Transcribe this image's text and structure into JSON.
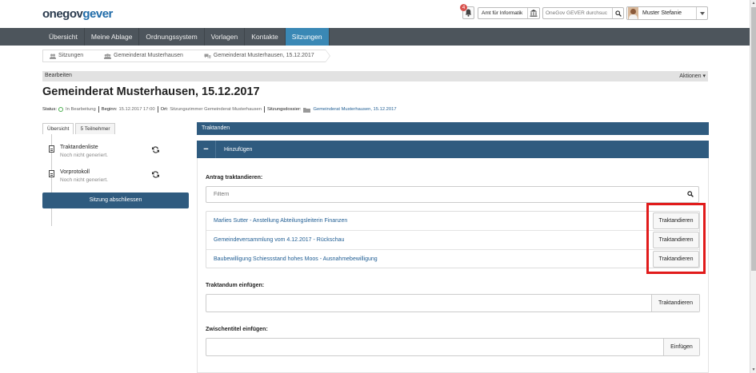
{
  "header": {
    "logo_one": "onegov",
    "logo_gever": "gever",
    "notification_count": "4",
    "org_unit": "Amt für Informatik",
    "search_placeholder": "OneGov GEVER durchsuc",
    "user_name": "Muster Stefanie"
  },
  "nav": {
    "items": [
      {
        "label": "Übersicht"
      },
      {
        "label": "Meine Ablage"
      },
      {
        "label": "Ordnungssystem"
      },
      {
        "label": "Vorlagen"
      },
      {
        "label": "Kontakte"
      },
      {
        "label": "Sitzungen"
      }
    ],
    "active": "Sitzungen"
  },
  "breadcrumb": [
    {
      "label": "Sitzungen"
    },
    {
      "label": "Gemeinderat Musterhausen"
    },
    {
      "label": "Gemeinderat Musterhausen, 15.12.2017"
    }
  ],
  "actionbar": {
    "edit_label": "Bearbeiten",
    "actions_label": "Aktionen ▾"
  },
  "page": {
    "title": "Gemeinderat Musterhausen, 15.12.2017",
    "meta": {
      "status_label": "Status:",
      "status_value": "In Bearbeitung",
      "start_label": "Beginn:",
      "start_value": "15.12.2017 17:00",
      "place_label": "Ort:",
      "place_value": "Sitzungszimmer Gemeinderat Musterhausen",
      "dossier_label": "Sitzungsdossier:",
      "dossier_value": "Gemeinderat Musterhausen, 15.12.2017"
    }
  },
  "left": {
    "tabs": [
      {
        "label": "Übersicht"
      },
      {
        "label": "5 Teilnehmer"
      }
    ],
    "docs": [
      {
        "title": "Traktandenliste",
        "sub": "Noch nicht generiert."
      },
      {
        "title": "Vorprotokoll",
        "sub": "Noch nicht generiert."
      }
    ],
    "close_button": "Sitzung abschliessen"
  },
  "right": {
    "panel_title": "Traktanden",
    "collapse_label": "Hinzufügen",
    "collapse_symbol": "−",
    "proposal_label": "Antrag traktandieren:",
    "filter_placeholder": "Filtern",
    "proposals": [
      {
        "title": "Marlies Sutter - Anstellung Abteilungsleiterin Finanzen",
        "button": "Traktandieren"
      },
      {
        "title": "Gemeindeversammlung vom 4.12.2017 - Rückschau",
        "button": "Traktandieren"
      },
      {
        "title": "Baubewilligung Schiessstand hohes Moos - Ausnahmebewilligung",
        "button": "Traktandieren"
      }
    ],
    "insert_item_label": "Traktandum einfügen:",
    "insert_item_button": "Traktandieren",
    "insert_heading_label": "Zwischentitel einfügen:",
    "insert_heading_button": "Einfügen"
  },
  "colors": {
    "nav_bg": "#4d555c",
    "nav_active": "#3a88b5",
    "panel_blue": "#2f5b7f",
    "link_blue": "#1f5d93",
    "highlight_red": "#e11b1b"
  }
}
